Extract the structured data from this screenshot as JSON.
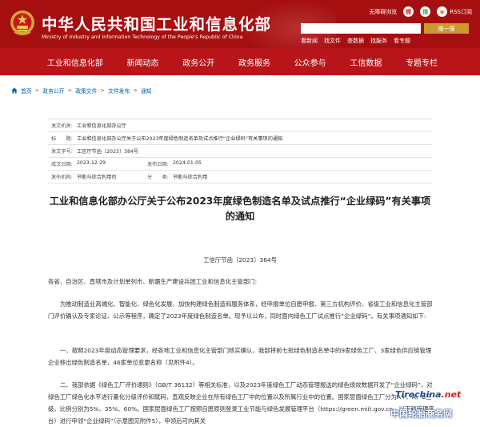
{
  "header": {
    "title": "中华人民共和国工业和信息化部",
    "subtitle": "Ministry of Industry and Information Technology of the People's Republic of China",
    "top_links": [
      {
        "label": "无障碍浏览",
        "icon": ""
      },
      {
        "label": "",
        "icon": "weibo-icon"
      },
      {
        "label": "",
        "icon": "wechat-icon"
      },
      {
        "label": "RSS订阅",
        "icon": "rss-icon"
      }
    ],
    "search_button": "搜一搜",
    "quick_links": [
      "看新闻",
      "找文件",
      "查数据",
      "找服务",
      "看专题"
    ]
  },
  "nav": {
    "items": [
      "工业和信息化部",
      "新闻动态",
      "政务公开",
      "政务服务",
      "公众参与",
      "工信数据",
      "专题专栏"
    ]
  },
  "breadcrumb": [
    "首页",
    "政务公开",
    "政策文件",
    "文件发布",
    "通知"
  ],
  "meta": {
    "issuer_label": "发文机关:",
    "issuer": "工业和信息化部办公厅",
    "title_label": "标　　题:",
    "title": "工业和信息化部办公厅关于公布2023年度绿色制造名单及试点推行“企业绿码”有关事项的通知",
    "docno_label": "发文字号:",
    "docno": "工信厅节函〔2023〕384号",
    "date_label": "成文日期:",
    "date": "2023-12-29",
    "pubdate_label": "发布日期:",
    "pubdate": "2024-01-05",
    "category_label": "发布机构:",
    "category": "节能与综合利用司",
    "class_label": "分　　类:",
    "class": "节能与综合利用"
  },
  "article": {
    "title": "工业和信息化部办公厅关于公布2023年度绿色制造名单及试点推行“企业绿码”有关事项的通知",
    "doc_number": "工信厅节函〔2023〕384号",
    "recipients": "各省、自治区、直辖市及计划单列市、新疆生产建设兵团工业和信息化主管部门:",
    "para1": "为推动制造业高端化、智能化、绿色化发展，加快构建绿色制造和服务体系，经申报单位自愿申报、第三方机构评价、省级工业和信息化主管部门评价确认及专家论证、公示等程序，确定了2023年度绿色制造名单。现予以公布，同时面向绿色工厂试点推行“企业绿码”。有关事项通知如下:",
    "para2": "一、按照2023年度动态管理要求，经各地工业和信息化主管部门核实确认，我部将前七批绿色制造名单中的9家绿色工厂、3家绿色供应链管理企业移出绿色制造名单，46家单位变更名称（见附件4）。",
    "para3": "二、我部依据《绿色工厂评价通则》（GB/T 36132）等相关标准，以及2023年度绿色工厂动态管理报送的绿色绩效数据开发了“企业绿码”，对绿色工厂绿色化水平进行量化分级评价和赋码，直观反映企业在所有绿色工厂中的位置以及所属行业中的位置。国家层面绿色工厂分为A+、A、B三级，比例分别为5%、35%、60%。国家层面绿色工厂按照自愿原则登录工业节能与绿色发展管理平台（https://green.miit.gov.cn，以下称管理平台）进行申领“企业绿码”（示意图见附件5），申领后可向其关"
  },
  "watermark": {
    "logo_main": "Tirechina",
    "logo_suffix": ".net",
    "text": "中国轮胎商务网"
  },
  "colors": {
    "header_bg": "#a60f10",
    "nav_bg": "#b7151a",
    "search_button": "#c99a2e",
    "link": "#0060a8"
  }
}
